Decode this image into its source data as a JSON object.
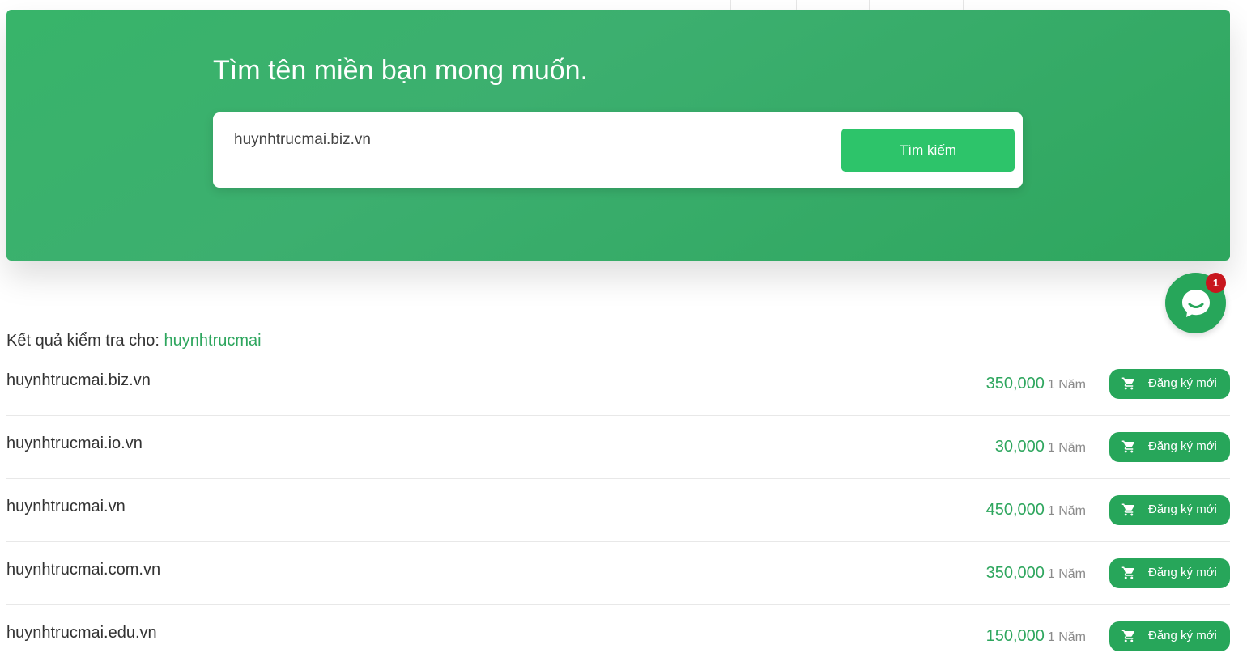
{
  "hero": {
    "title": "Tìm tên miền bạn mong muốn.",
    "search_value": "huynhtrucmai.biz.vn",
    "search_button": "Tìm kiếm"
  },
  "chat": {
    "badge_count": "1",
    "icon": "chat-bubble-icon"
  },
  "results": {
    "heading_prefix": "Kết quả kiểm tra cho:",
    "term": "huynhtrucmai",
    "rows": [
      {
        "domain": "huynhtrucmai.biz.vn",
        "price": "350,000",
        "period": "1 Năm",
        "button": "Đăng ký mới"
      },
      {
        "domain": "huynhtrucmai.io.vn",
        "price": "30,000",
        "period": "1 Năm",
        "button": "Đăng ký mới"
      },
      {
        "domain": "huynhtrucmai.vn",
        "price": "450,000",
        "period": "1 Năm",
        "button": "Đăng ký mới"
      },
      {
        "domain": "huynhtrucmai.com.vn",
        "price": "350,000",
        "period": "1 Năm",
        "button": "Đăng ký mới"
      },
      {
        "domain": "huynhtrucmai.edu.vn",
        "price": "150,000",
        "period": "1 Năm",
        "button": "Đăng ký mới"
      }
    ]
  },
  "colors": {
    "brand_green": "#2ea65e",
    "button_green": "#2dc46a",
    "badge_red": "#c8161d"
  }
}
